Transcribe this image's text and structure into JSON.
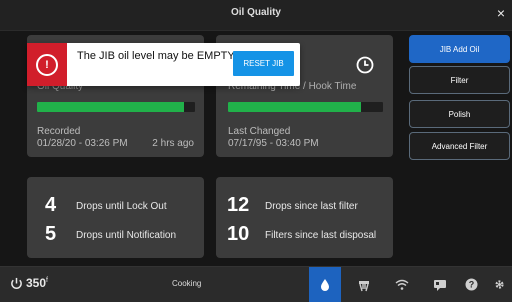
{
  "window": {
    "title": "Oil Quality"
  },
  "cards": {
    "top_left": {
      "label_hidden": "Oil Quality",
      "progress": 0.93,
      "recorded_label": "Recorded",
      "recorded_value": "01/28/20 - 03:26 PM",
      "recorded_ago": "2 hrs ago"
    },
    "top_right": {
      "label_hidden": "Remaining Time / Hook Time",
      "progress": 0.86,
      "changed_label": "Last Changed",
      "changed_value": "07/17/95 - 03:40 PM"
    },
    "bottom_left": {
      "items": [
        {
          "value": "4",
          "label": "Drops until Lock Out"
        },
        {
          "value": "5",
          "label": "Drops until Notification"
        }
      ]
    },
    "bottom_right": {
      "items": [
        {
          "value": "12",
          "label": "Drops since last filter"
        },
        {
          "value": "10",
          "label": "Filters since last disposal"
        }
      ]
    }
  },
  "right_buttons": [
    {
      "label": "JIB Add Oil"
    },
    {
      "label": "Filter"
    },
    {
      "label": "Polish"
    },
    {
      "label": "Advanced Filter"
    }
  ],
  "alert": {
    "message": "The JIB oil level may be EMPTY",
    "button": "RESET JIB"
  },
  "bottom_bar": {
    "power_value": "350",
    "power_unit": "f",
    "status": "Cooking",
    "icons": [
      {
        "name": "oil-drop-icon"
      },
      {
        "name": "fryer-icon"
      },
      {
        "name": "wifi-icon"
      },
      {
        "name": "message-icon"
      },
      {
        "name": "help-icon"
      },
      {
        "name": "gear-icon"
      }
    ],
    "accent": "#1d63bf"
  },
  "colors": {
    "background": "#161616",
    "card": "#3c3c3c",
    "progress_green": "#21b14a",
    "primary_blue": "#1f67c6",
    "alert_red": "#d11e2b"
  }
}
